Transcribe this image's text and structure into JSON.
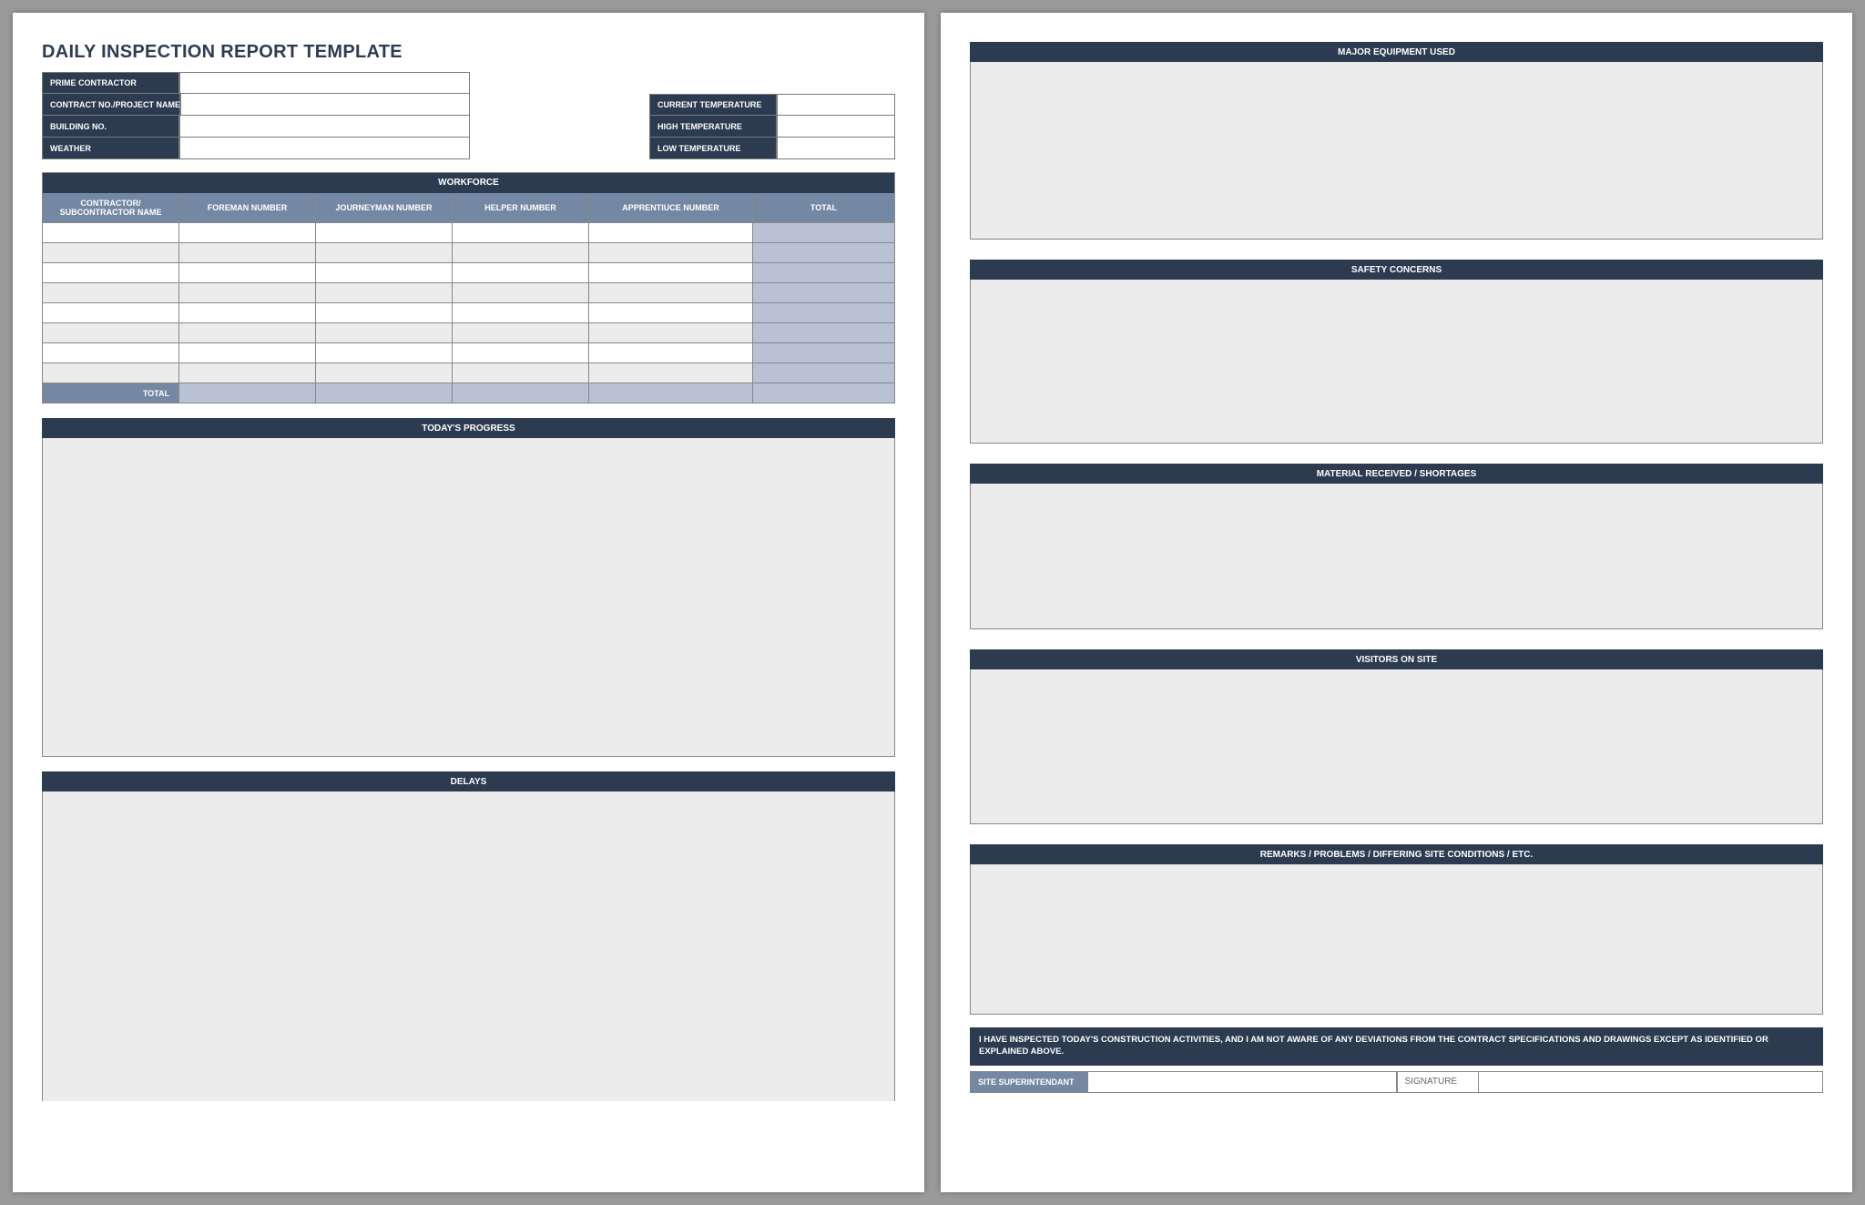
{
  "page1": {
    "title": "DAILY INSPECTION REPORT TEMPLATE",
    "meta_left": {
      "prime_contractor_label": "PRIME CONTRACTOR",
      "prime_contractor_value": "",
      "contract_label": "CONTRACT NO./PROJECT NAME",
      "contract_value": "",
      "building_label": "BUILDING NO.",
      "building_value": "",
      "weather_label": "WEATHER",
      "weather_value": ""
    },
    "meta_right": {
      "current_temp_label": "CURRENT TEMPERATURE",
      "current_temp_value": "",
      "high_temp_label": "HIGH TEMPERATURE",
      "high_temp_value": "",
      "low_temp_label": "LOW TEMPERATURE",
      "low_temp_value": ""
    },
    "workforce": {
      "header": "WORKFORCE",
      "cols": {
        "c1": "CONTRACTOR/ SUBCONTRACTOR NAME",
        "c2": "FOREMAN NUMBER",
        "c3": "JOURNEYMAN NUMBER",
        "c4": "HELPER NUMBER",
        "c5": "APPRENTIUCE NUMBER",
        "c6": "TOTAL"
      },
      "total_label": "TOTAL"
    },
    "progress_header": "TODAY'S PROGRESS",
    "delays_header": "DELAYS"
  },
  "page2": {
    "sections": {
      "equipment": "MAJOR EQUIPMENT USED",
      "safety": "SAFETY CONCERNS",
      "material": "MATERIAL RECEIVED / SHORTAGES",
      "visitors": "VISITORS ON SITE",
      "remarks": "REMARKS / PROBLEMS / DIFFERING SITE CONDITIONS / ETC."
    },
    "declaration": "I HAVE INSPECTED TODAY'S CONSTRUCTION ACTIVITIES, AND I AM NOT AWARE OF ANY DEVIATIONS FROM THE CONTRACT SPECIFICATIONS AND DRAWINGS EXCEPT AS IDENTIFIED OR EXPLAINED ABOVE.",
    "signature": {
      "super_label": "SITE SUPERINTENDANT",
      "super_value": "",
      "sig_label": "SIGNATURE",
      "sig_value": ""
    }
  }
}
